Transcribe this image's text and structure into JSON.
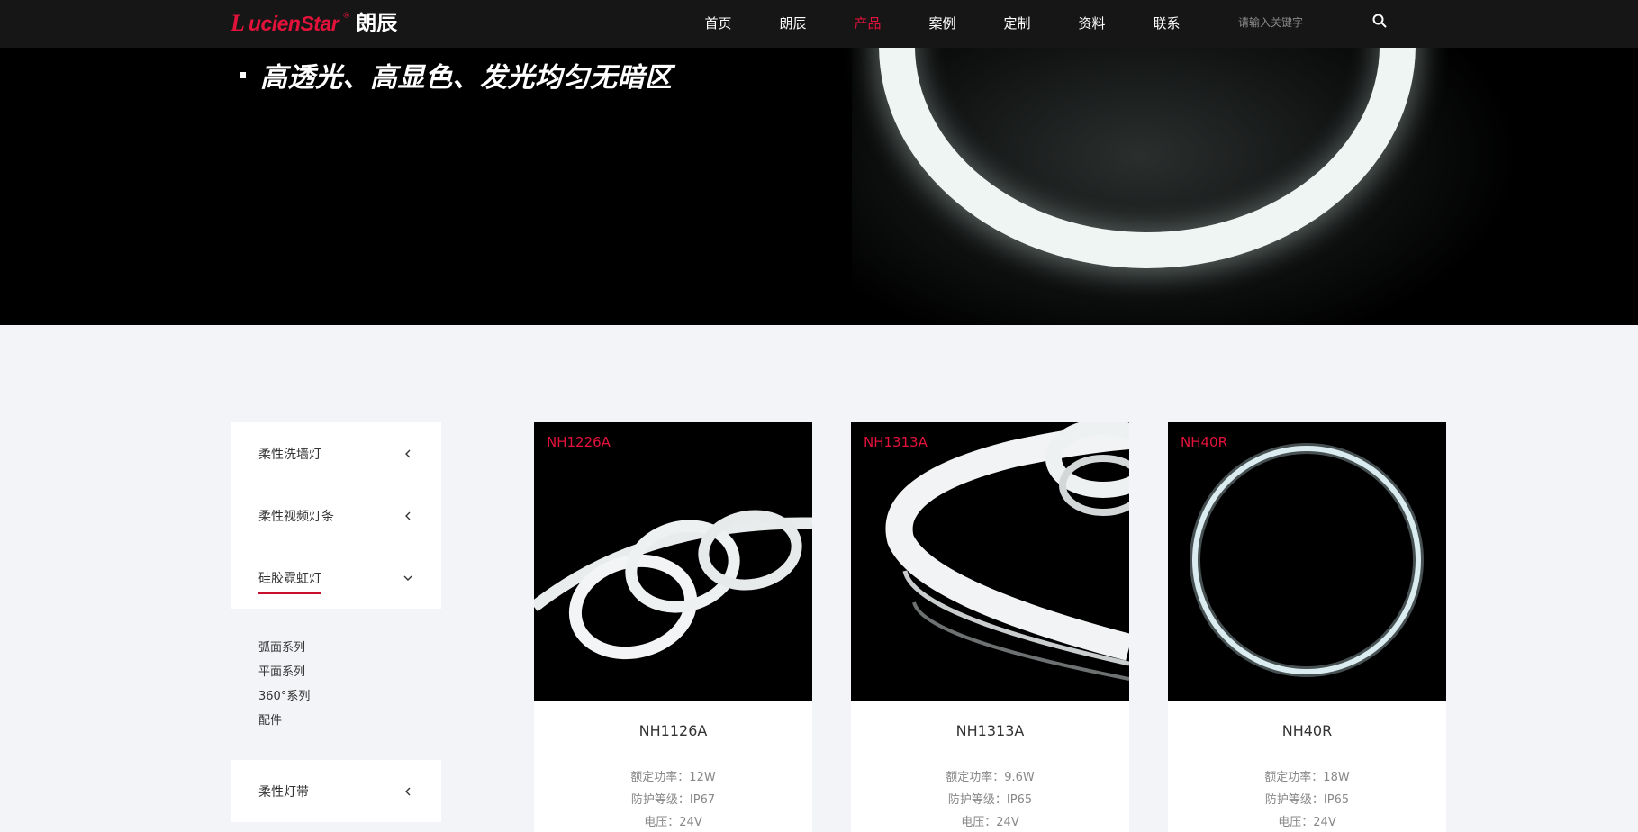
{
  "header": {
    "logo_mark": "L",
    "logo_text": "ucienStar",
    "logo_reg": "®",
    "logo_cn": "朗辰",
    "nav": [
      "首页",
      "朗辰",
      "产品",
      "案例",
      "定制",
      "资料",
      "联系"
    ],
    "active_nav": "产品",
    "search_placeholder": "请输入关键字"
  },
  "banner": {
    "slogan": "高透光、高显色、发光均匀无暗区"
  },
  "sidebar": {
    "categories": [
      "柔性洗墙灯",
      "柔性视频灯条",
      "硅胶霓虹灯"
    ],
    "active_category": "硅胶霓虹灯",
    "subitems": [
      "弧面系列",
      "平面系列",
      "360°系列",
      "配件"
    ],
    "bottom_category": "柔性灯带"
  },
  "products": [
    {
      "code": "NH1226A",
      "name": "NH1126A",
      "specs": [
        "额定功率：12W",
        "防护等级：IP67",
        "电压：24V"
      ]
    },
    {
      "code": "NH1313A",
      "name": "NH1313A",
      "specs": [
        "额定功率：9.6W",
        "防护等级：IP65",
        "电压：24V"
      ]
    },
    {
      "code": "NH40R",
      "name": "NH40R",
      "specs": [
        "额定功率：18W",
        "防护等级：IP65",
        "电压：24V"
      ]
    }
  ],
  "colors": {
    "brand": "#e3123b",
    "header_bg": "#161616",
    "page_bg": "#f3f4f8"
  },
  "icons": {
    "search": "search-icon",
    "chevron_left": "chevron-left-icon",
    "chevron_down": "chevron-down-icon"
  }
}
